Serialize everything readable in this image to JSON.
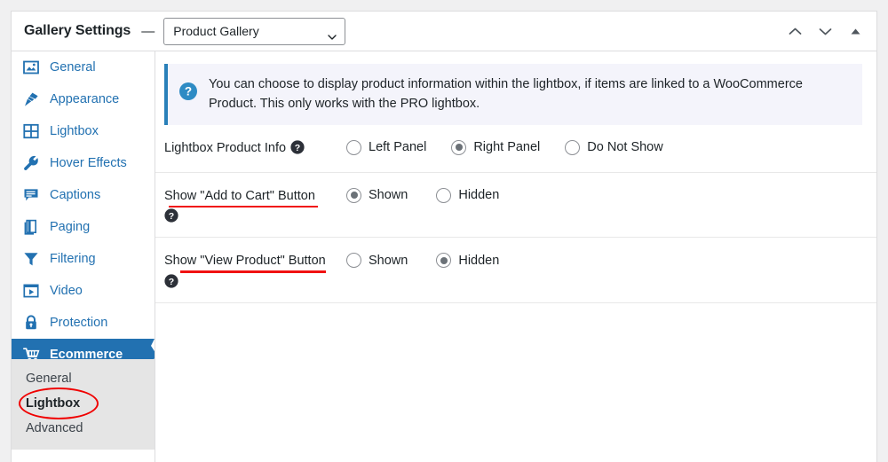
{
  "header": {
    "title": "Gallery Settings",
    "dash": "—",
    "gallery_select": {
      "value": "Product Gallery",
      "icon": "chevron-down-icon"
    },
    "actions": [
      {
        "name": "collapse-up-icon",
        "glyph": "chevron-up"
      },
      {
        "name": "expand-down-icon",
        "glyph": "chevron-down"
      },
      {
        "name": "toggle-panel-icon",
        "glyph": "triangle-up"
      }
    ]
  },
  "sidebar": {
    "items": [
      {
        "label": "General",
        "icon": "image-icon"
      },
      {
        "label": "Appearance",
        "icon": "paintbrush-icon"
      },
      {
        "label": "Lightbox",
        "icon": "grid-icon"
      },
      {
        "label": "Hover Effects",
        "icon": "wrench-icon"
      },
      {
        "label": "Captions",
        "icon": "caption-icon"
      },
      {
        "label": "Paging",
        "icon": "book-icon"
      },
      {
        "label": "Filtering",
        "icon": "funnel-icon"
      },
      {
        "label": "Video",
        "icon": "video-icon"
      },
      {
        "label": "Protection",
        "icon": "lock-icon"
      },
      {
        "label": "Ecommerce",
        "icon": "cart-icon",
        "active": true
      }
    ],
    "subnav": {
      "items": [
        {
          "label": "General"
        },
        {
          "label": "Lightbox",
          "current": true,
          "annotated": true
        },
        {
          "label": "Advanced"
        }
      ]
    }
  },
  "content": {
    "notice": {
      "icon": "question-circle-icon",
      "text": "You can choose to display product information within the lightbox, if items are linked to a WooCommerce Product. This only works with the PRO lightbox."
    },
    "fields": [
      {
        "label": "Lightbox Product Info",
        "help_icon": "help-icon",
        "help_position": "inline",
        "annotated": false,
        "options": [
          {
            "label": "Left Panel",
            "checked": false
          },
          {
            "label": "Right Panel",
            "checked": true
          },
          {
            "label": "Do Not Show",
            "checked": false
          }
        ]
      },
      {
        "label": "Show \"Add to Cart\" Button",
        "help_icon": "help-icon",
        "help_position": "below",
        "annotated": true,
        "options": [
          {
            "label": "Shown",
            "checked": true
          },
          {
            "label": "Hidden",
            "checked": false
          }
        ]
      },
      {
        "label": "Show \"View Product\" Button",
        "help_icon": "help-icon",
        "help_position": "below",
        "annotated": true,
        "options": [
          {
            "label": "Shown",
            "checked": false
          },
          {
            "label": "Hidden",
            "checked": true
          }
        ]
      }
    ]
  },
  "colors": {
    "accent_blue": "#2271b1",
    "notice_blue": "#2980b9",
    "notice_bg": "#f4f4fb",
    "annotation_red": "#f11212",
    "page_bg": "#f0f0f1",
    "subnav_bg": "#e5e5e5"
  }
}
